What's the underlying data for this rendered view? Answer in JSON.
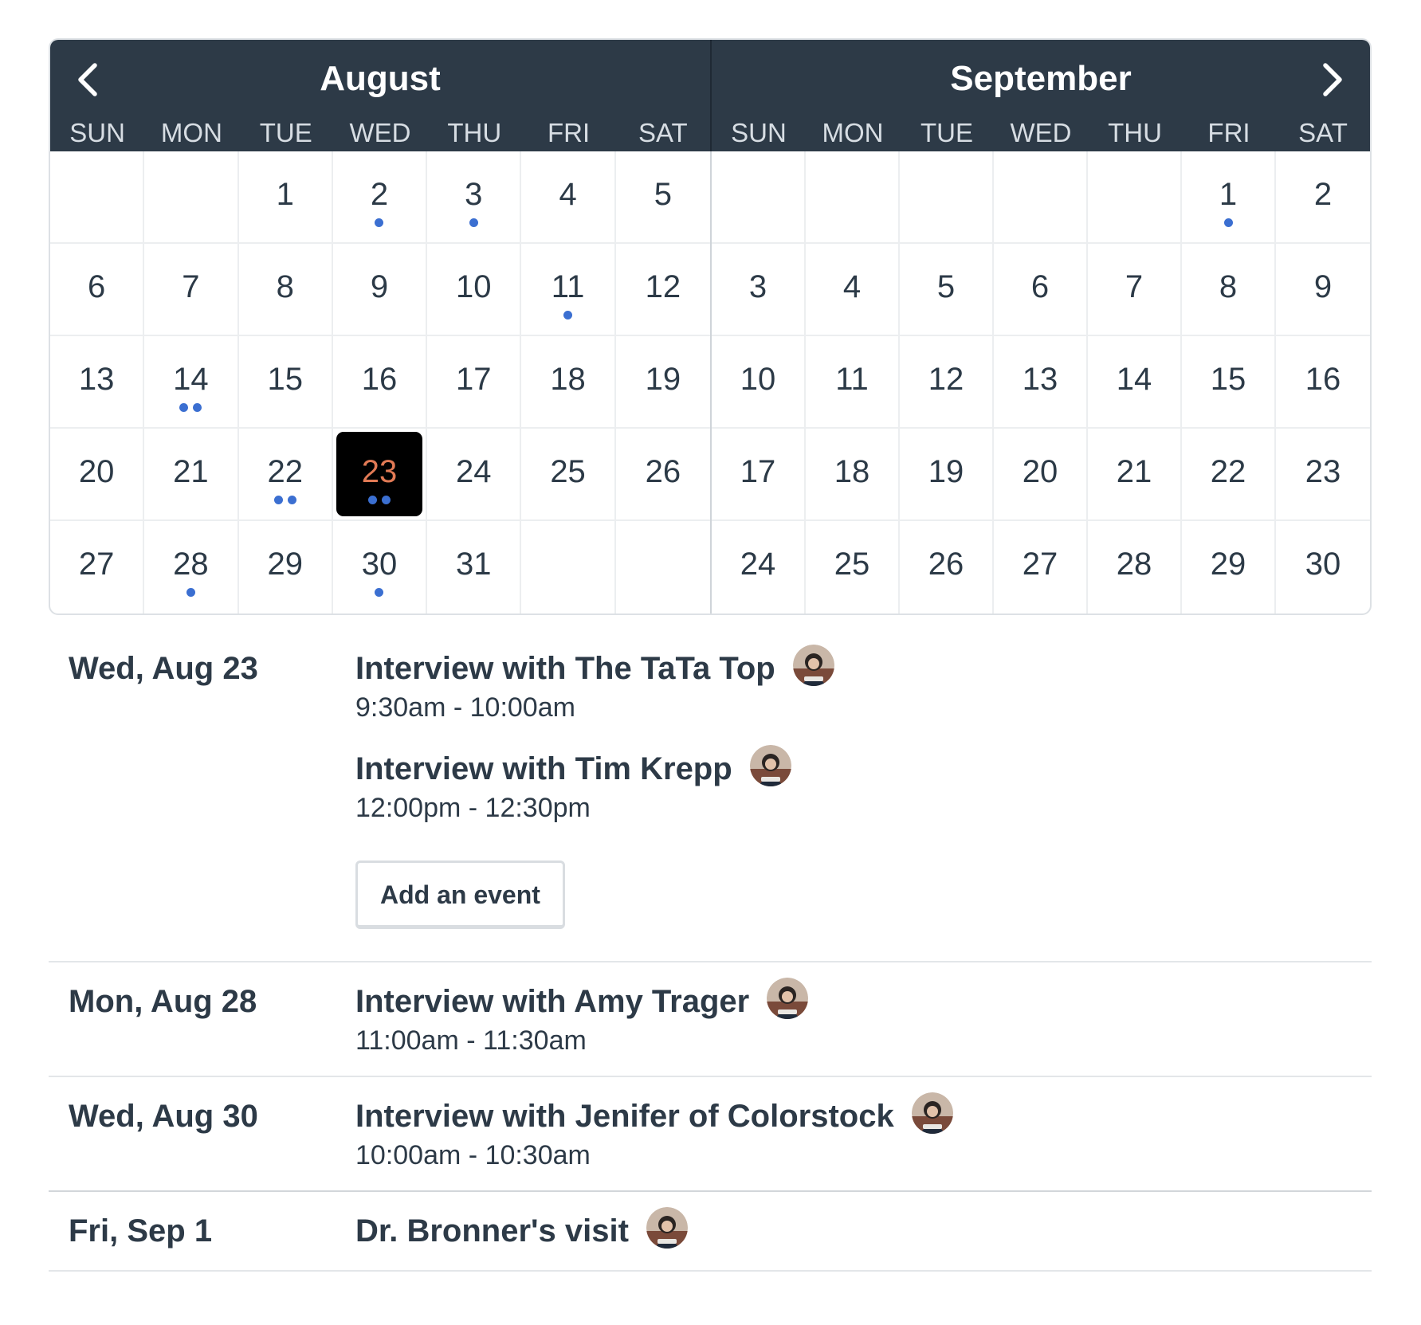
{
  "calendar": {
    "months": [
      {
        "title": "August",
        "weekdays": [
          "SUN",
          "MON",
          "TUE",
          "WED",
          "THU",
          "FRI",
          "SAT"
        ],
        "days": [
          {
            "num": ""
          },
          {
            "num": ""
          },
          {
            "num": "1"
          },
          {
            "num": "2",
            "dots": 1
          },
          {
            "num": "3",
            "dots": 1
          },
          {
            "num": "4"
          },
          {
            "num": "5"
          },
          {
            "num": "6"
          },
          {
            "num": "7"
          },
          {
            "num": "8"
          },
          {
            "num": "9"
          },
          {
            "num": "10"
          },
          {
            "num": "11",
            "dots": 1
          },
          {
            "num": "12"
          },
          {
            "num": "13"
          },
          {
            "num": "14",
            "dots": 2
          },
          {
            "num": "15"
          },
          {
            "num": "16"
          },
          {
            "num": "17"
          },
          {
            "num": "18"
          },
          {
            "num": "19"
          },
          {
            "num": "20"
          },
          {
            "num": "21"
          },
          {
            "num": "22",
            "dots": 2
          },
          {
            "num": "23",
            "dots": 2,
            "selected": true
          },
          {
            "num": "24"
          },
          {
            "num": "25"
          },
          {
            "num": "26"
          },
          {
            "num": "27"
          },
          {
            "num": "28",
            "dots": 1
          },
          {
            "num": "29"
          },
          {
            "num": "30",
            "dots": 1
          },
          {
            "num": "31"
          },
          {
            "num": ""
          },
          {
            "num": ""
          }
        ]
      },
      {
        "title": "September",
        "weekdays": [
          "SUN",
          "MON",
          "TUE",
          "WED",
          "THU",
          "FRI",
          "SAT"
        ],
        "days": [
          {
            "num": ""
          },
          {
            "num": ""
          },
          {
            "num": ""
          },
          {
            "num": ""
          },
          {
            "num": ""
          },
          {
            "num": "1",
            "dots": 1
          },
          {
            "num": "2"
          },
          {
            "num": "3"
          },
          {
            "num": "4"
          },
          {
            "num": "5"
          },
          {
            "num": "6"
          },
          {
            "num": "7"
          },
          {
            "num": "8"
          },
          {
            "num": "9"
          },
          {
            "num": "10"
          },
          {
            "num": "11"
          },
          {
            "num": "12"
          },
          {
            "num": "13"
          },
          {
            "num": "14"
          },
          {
            "num": "15"
          },
          {
            "num": "16"
          },
          {
            "num": "17"
          },
          {
            "num": "18"
          },
          {
            "num": "19"
          },
          {
            "num": "20"
          },
          {
            "num": "21"
          },
          {
            "num": "22"
          },
          {
            "num": "23"
          },
          {
            "num": "24"
          },
          {
            "num": "25"
          },
          {
            "num": "26"
          },
          {
            "num": "27"
          },
          {
            "num": "28"
          },
          {
            "num": "29"
          },
          {
            "num": "30"
          }
        ]
      }
    ],
    "nav": {
      "prev_icon": "chevron-left-icon",
      "next_icon": "chevron-right-icon"
    },
    "colors": {
      "header_bg": "#2d3a47",
      "selected_bg": "#000000",
      "selected_text": "#e27a55",
      "event_dot": "#3b6fd1"
    }
  },
  "agenda": [
    {
      "date": "Wed, Aug 23",
      "events": [
        {
          "title": "Interview with The TaTa Top",
          "time": "9:30am - 10:00am"
        },
        {
          "title": "Interview with Tim Krepp",
          "time": "12:00pm - 12:30pm"
        }
      ],
      "add_button": "Add an event"
    },
    {
      "date": "Mon, Aug 28",
      "events": [
        {
          "title": "Interview with Amy Trager",
          "time": "11:00am - 11:30am"
        }
      ]
    },
    {
      "date": "Wed, Aug 30",
      "events": [
        {
          "title": "Interview with Jenifer of Colorstock",
          "time": "10:00am - 10:30am"
        }
      ]
    },
    {
      "date": "Fri, Sep 1",
      "events": [
        {
          "title": "Dr. Bronner's visit",
          "time": ""
        }
      ]
    }
  ]
}
